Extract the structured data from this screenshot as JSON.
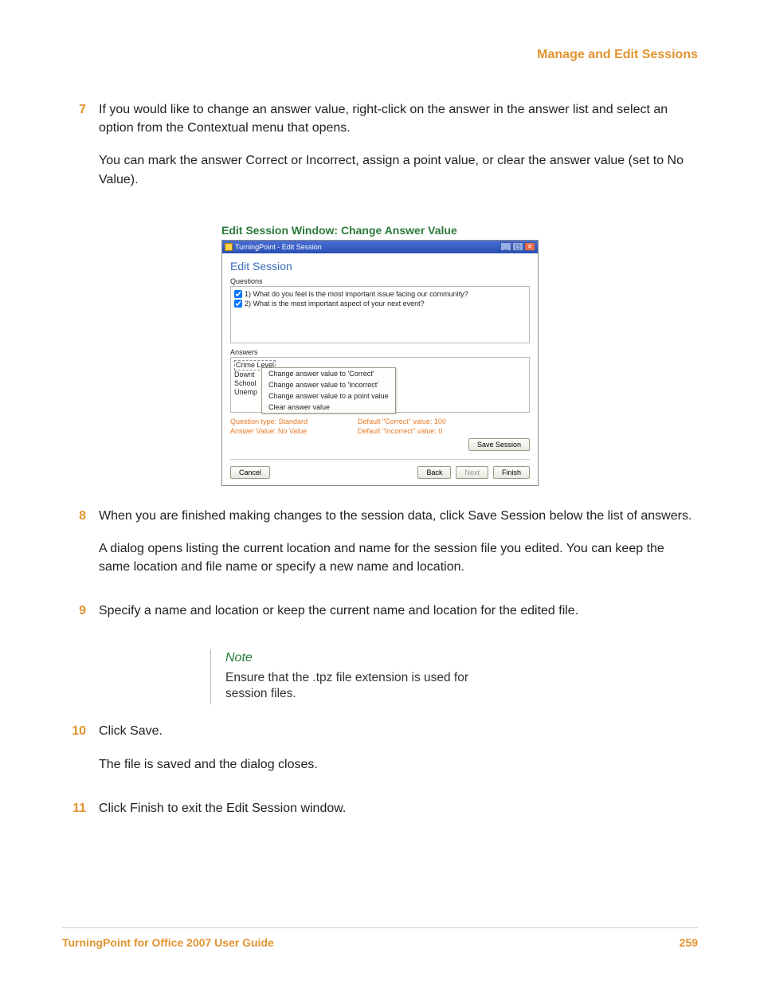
{
  "header": {
    "title": "Manage and Edit Sessions"
  },
  "steps": {
    "s7": {
      "num": "7",
      "p1": "If you would like to change an answer value, right-click on the answer in the answer list and select an option from the Contextual menu that opens.",
      "p2": "You can mark the answer Correct or Incorrect, assign a point value, or clear the answer value (set to No Value)."
    },
    "s8": {
      "num": "8",
      "p1": "When you are finished making changes to the session data, click Save Session below the list of answers.",
      "p2": "A dialog opens listing the current location and name for the session file you edited. You can keep the same location and file name or specify a new name and location."
    },
    "s9": {
      "num": "9",
      "p1": "Specify a name and location or keep the current name and location for the edited file."
    },
    "s10": {
      "num": "10",
      "p1": "Click Save.",
      "p2": "The file is saved and the dialog closes."
    },
    "s11": {
      "num": "11",
      "p1": "Click Finish to exit the Edit Session window."
    }
  },
  "figure": {
    "caption": "Edit Session Window: Change Answer Value",
    "titlebar": "TurningPoint - Edit Session",
    "heading": "Edit Session",
    "questions_label": "Questions",
    "q1": "1) What do you feel is the most important issue facing our community?",
    "q2": "2) What is the most important aspect of your next event?",
    "answers_label": "Answers",
    "ans_sel": "Crime Level",
    "ans_partial1": "Downt",
    "ans_partial2": "School",
    "ans_partial3": "Unemp",
    "ctx": {
      "c1": "Change answer value to 'Correct'",
      "c2": "Change answer value to 'Incorrect'",
      "c3": "Change answer value to a point value",
      "c4": "Clear answer value"
    },
    "info1_l": "Question type: Standard",
    "info1_r": "Default \"Correct\" value: 100",
    "info2_l": "Answer Value: No Value",
    "info2_r": "Default \"Incorrect\" value: 0",
    "btn_save": "Save Session",
    "btn_cancel": "Cancel",
    "btn_back": "Back",
    "btn_next": "Next",
    "btn_finish": "Finish"
  },
  "note": {
    "title": "Note",
    "body": "Ensure that the .tpz file extension is used for session files."
  },
  "footer": {
    "left": "TurningPoint for Office 2007 User Guide",
    "right": "259"
  }
}
